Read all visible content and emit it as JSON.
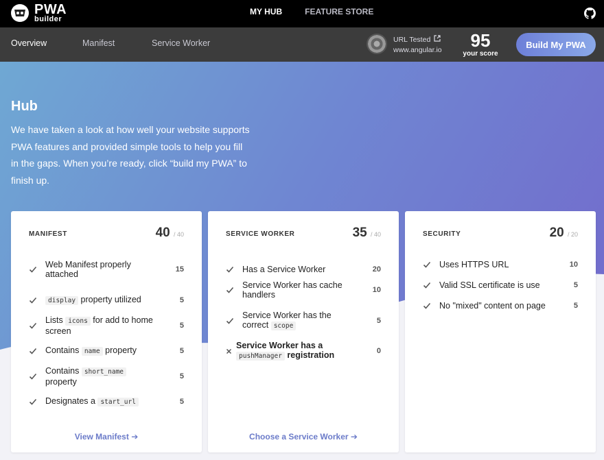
{
  "brand": {
    "logo_main": "PWA",
    "logo_sub": "builder"
  },
  "topnav": {
    "hub": "MY HUB",
    "store": "FEATURE STORE"
  },
  "subnav": {
    "overview": "Overview",
    "manifest": "Manifest",
    "service_worker": "Service Worker"
  },
  "url": {
    "label": "URL Tested",
    "value": "www.angular.io"
  },
  "score": {
    "value": "95",
    "label": "your score"
  },
  "build_label": "Build My PWA",
  "hero": {
    "title": "Hub",
    "text": "We have taken a look at how well your website supports PWA features and provided simple tools to help you fill in the gaps. When you’re ready, click “build my PWA” to finish up."
  },
  "cards": [
    {
      "title": "MANIFEST",
      "score": "40",
      "max": "/ 40",
      "link": "View Manifest",
      "items": [
        {
          "pre": "Web Manifest properly attached",
          "points": "15"
        },
        {
          "code": "display",
          "post": " property utilized",
          "points": "5"
        },
        {
          "pre": "Lists ",
          "code": "icons",
          "post": " for add to home screen",
          "points": "5"
        },
        {
          "pre": "Contains ",
          "code": "name",
          "post": " property",
          "points": "5"
        },
        {
          "pre": "Contains ",
          "code": "short_name",
          "post": " property",
          "points": "5"
        },
        {
          "pre": "Designates a ",
          "code": "start_url",
          "points": "5"
        }
      ]
    },
    {
      "title": "SERVICE WORKER",
      "score": "35",
      "max": "/ 40",
      "link": "Choose a Service Worker",
      "items": [
        {
          "pre": "Has a Service Worker",
          "points": "20"
        },
        {
          "pre": "Service Worker has cache handlers",
          "points": "10"
        },
        {
          "pre": "Service Worker has the correct ",
          "code": "scope",
          "points": "5"
        },
        {
          "pre": "Service Worker has a ",
          "code": "pushManager",
          "post": " registration",
          "points": "0"
        }
      ]
    },
    {
      "title": "SECURITY",
      "score": "20",
      "max": "/ 20",
      "items": [
        {
          "pre": "Uses HTTPS URL",
          "points": "10"
        },
        {
          "pre": "Valid SSL certificate is use",
          "points": "5"
        },
        {
          "pre": "No \"mixed\" content on page",
          "points": "5"
        }
      ]
    }
  ],
  "colors": {
    "accent": "#6b7bc9",
    "topbar": "#000000",
    "subbar": "#3c3c3c"
  }
}
